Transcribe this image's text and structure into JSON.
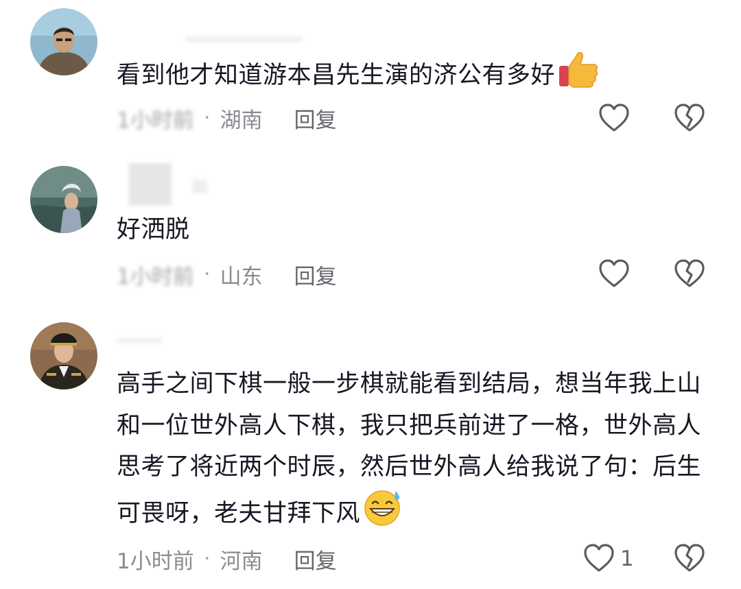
{
  "comments": [
    {
      "avatar_icon": "user-avatar-man",
      "content": "看到他才知道游本昌先生演的济公有多好",
      "emoji": "thumbs-up-emoji",
      "time": "1小时前",
      "location": "湖南",
      "reply_label": "回复",
      "like_count": ""
    },
    {
      "avatar_icon": "user-avatar-woman",
      "content": "好洒脱",
      "time": "1小时前",
      "location": "山东",
      "reply_label": "回复",
      "like_count": ""
    },
    {
      "avatar_icon": "user-avatar-uniform",
      "content": "高手之间下棋一般一步棋就能看到结局，想当年我上山和一位世外高人下棋，我只把兵前进了一格，世外高人思考了将近两个时辰，然后世外高人给我说了句：后生可畏呀，老夫甘拜下风",
      "emoji": "grinning-sweat-emoji",
      "time": "1小时前",
      "location": "河南",
      "reply_label": "回复",
      "like_count": "1"
    }
  ],
  "separator": "·",
  "colors": {
    "text_primary": "#161823",
    "text_secondary": "#8a8b91",
    "icon_outline": "#5a5b60"
  }
}
